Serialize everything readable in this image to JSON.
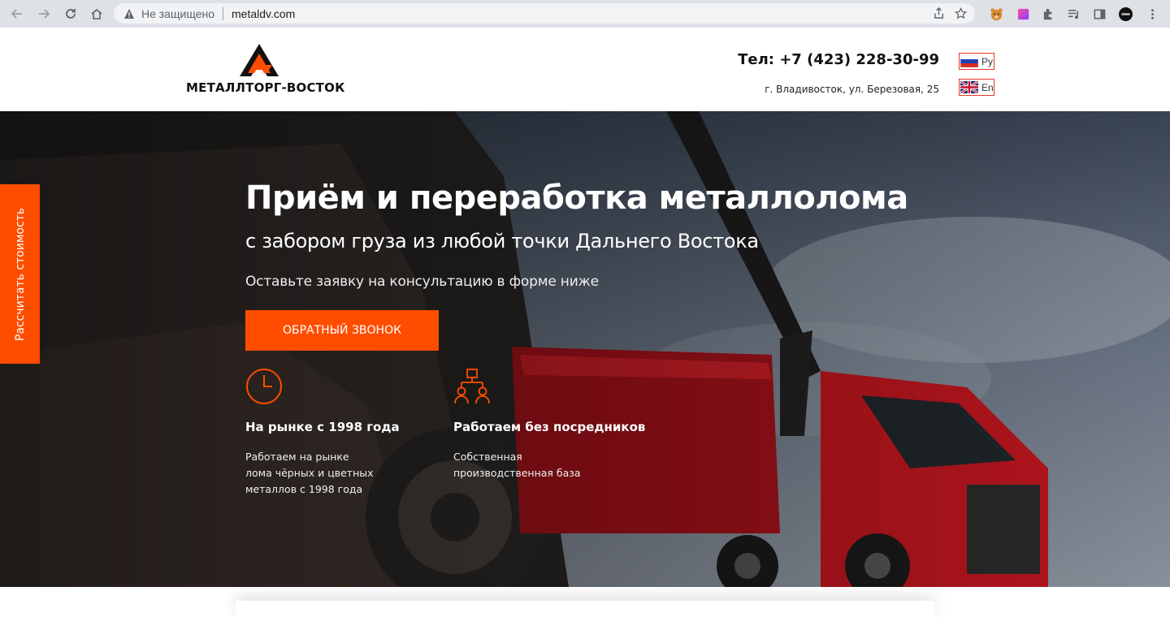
{
  "browser": {
    "security_label": "Не защищено",
    "url": "metaldv.com"
  },
  "header": {
    "logo_text": "МЕТАЛЛТОРГ-ВОСТОК",
    "phone": "Тел: +7 (423) 228-30-99",
    "address": "г. Владивосток, ул. Березовая, 25",
    "lang_ru": "Ру",
    "lang_en": "En"
  },
  "hero": {
    "title": "Приём и переработка металлолома",
    "subtitle": "с забором груза из любой точки Дальнего Востока",
    "note": "Оставьте заявку на консультацию в форме ниже",
    "cta_label": "ОБРАТНЫЙ ЗВОНОК",
    "features": [
      {
        "icon": "clock-icon",
        "title": "На рынке с 1998 года",
        "desc": "Работаем на рынке\nлома чёрных и цветных\nметаллов с 1998 года"
      },
      {
        "icon": "org-structure-icon",
        "title": "Работаем без посредников",
        "desc": "Собственная\nпроизводственная база"
      }
    ]
  },
  "side_tab": {
    "label": "Рассчитать стоимость"
  },
  "colors": {
    "accent": "#ff4d00",
    "lang_border": "#e23a2a"
  }
}
